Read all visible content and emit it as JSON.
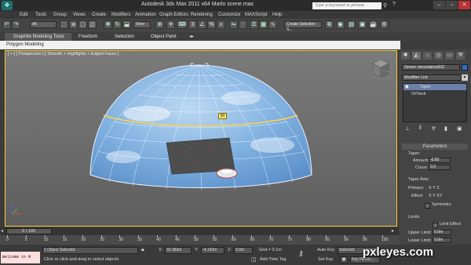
{
  "app": {
    "title": "Autodesk 3ds Max  2011 x64       Marlo scene.max",
    "search_placeholder": "Type a keyword or phrase"
  },
  "menus": [
    "Edit",
    "Tools",
    "Group",
    "Views",
    "Create",
    "Modifiers",
    "Animation",
    "Graph Editors",
    "Rendering",
    "Customize",
    "MAXScript",
    "Help"
  ],
  "toolbar": {
    "selection_filter": "All",
    "reference_coord": "View",
    "named_selection": "Create Selection S..."
  },
  "ribbon": {
    "tabs": [
      "Graphite Modeling Tools",
      "Freeform",
      "Selection",
      "Object Paint"
    ],
    "subtab": "Polygon Modeling"
  },
  "viewport": {
    "label": "[ + ] [ Perspective ] [ Smooth + Highlights + Edged Faces ]",
    "badge": "90"
  },
  "command_panel": {
    "object_name": "Green mountains002",
    "modifier_list": "Modifier List",
    "stack": [
      "Taper",
      "OilTank"
    ],
    "parameters": {
      "title": "Parameters",
      "taper_label": "Taper:",
      "amount_label": "Amount:",
      "amount_value": "-0.83",
      "curve_label": "Curve:",
      "curve_value": "0.0",
      "axis_label": "Taper Axis:",
      "primary_label": "Primary:",
      "primary_options": "X  Y  Z",
      "effect_label": "Effect:",
      "effect_options": "X  Y  XY",
      "symmetry_label": "Symmetry",
      "limits_label": "Limits",
      "limit_effect_label": "Limit Effect",
      "upper_limit_label": "Upper Limit:",
      "upper_limit_value": "0.0m",
      "lower_limit_label": "Lower Limit:",
      "lower_limit_value": "0.0m"
    }
  },
  "timeline": {
    "frame_display": "0 / 100",
    "ticks": [
      "0",
      "5",
      "10",
      "15",
      "20",
      "25",
      "30",
      "35",
      "40",
      "45",
      "50",
      "55",
      "60",
      "65",
      "70",
      "75",
      "80",
      "85",
      "90",
      "95",
      "100"
    ]
  },
  "status": {
    "listener_text": "Welcome to M",
    "selected_text": "1 Object Selected",
    "prompt_text": "Click or click-and-drag to select objects",
    "x_value": "32.363m",
    "y_value": "-4.122m",
    "z_value": "0.0m",
    "grid_text": "Grid = 0.1m",
    "add_time_tag": "Add Time Tag",
    "auto_key": "Auto Key",
    "set_key": "Set Key",
    "key_mode": "Selected",
    "key_filters": "Key Filters..."
  },
  "watermark": "pxleyes.com",
  "colors": {
    "viewport_border": "#ffcc33",
    "dome_fill": "#6fa4d8",
    "dome_edge": "#ffd24a",
    "listener_bg": "#ffdede"
  }
}
